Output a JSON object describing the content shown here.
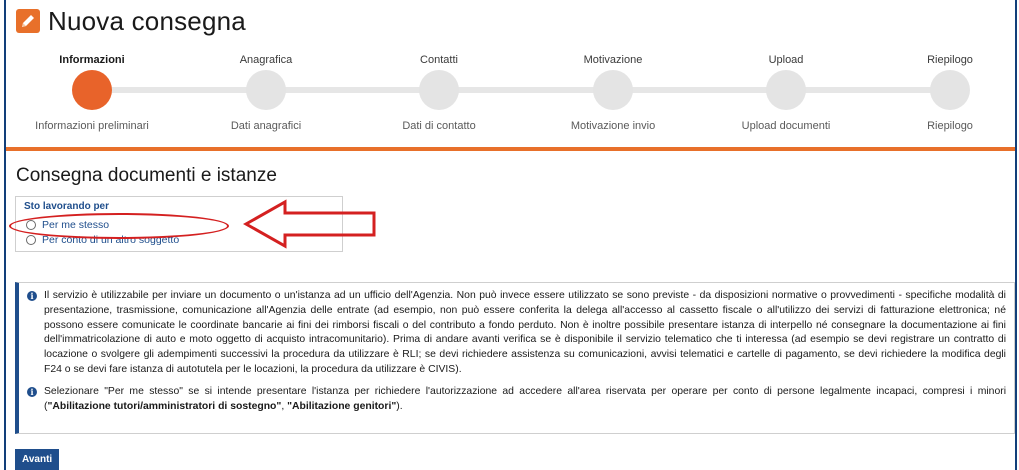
{
  "header": {
    "title": "Nuova consegna",
    "icon": "pencil-icon",
    "icon_color": "#e8702a"
  },
  "stepper": {
    "active_color": "#e8632a",
    "steps": [
      {
        "title": "Informazioni",
        "subtitle": "Informazioni preliminari",
        "active": true
      },
      {
        "title": "Anagrafica",
        "subtitle": "Dati anagrafici",
        "active": false
      },
      {
        "title": "Contatti",
        "subtitle": "Dati di contatto",
        "active": false
      },
      {
        "title": "Motivazione",
        "subtitle": "Motivazione invio",
        "active": false
      },
      {
        "title": "Upload",
        "subtitle": "Upload documenti",
        "active": false
      },
      {
        "title": "Riepilogo",
        "subtitle": "Riepilogo",
        "active": false
      }
    ]
  },
  "main": {
    "section_title": "Consegna documenti e istanze",
    "working_for": {
      "legend": "Sto lavorando per",
      "options": [
        {
          "label": "Per me stesso",
          "selected": false
        },
        {
          "label": "Per conto di un altro soggetto",
          "selected": false
        }
      ]
    },
    "info": [
      "Il servizio è utilizzabile per inviare un documento o un'istanza ad un ufficio dell'Agenzia. Non può invece essere utilizzato se sono previste - da disposizioni normative o provvedimenti - specifiche modalità di presentazione, trasmissione, comunicazione all'Agenzia delle entrate (ad esempio, non può essere conferita la delega all'accesso al cassetto fiscale o all'utilizzo dei servizi di fatturazione elettronica; né possono essere comunicate le coordinate bancarie ai fini dei rimborsi fiscali o del contributo a fondo perduto. Non è inoltre possibile presentare istanza di interpello né consegnare la documentazione ai fini dell'immatricolazione di auto e moto oggetto di acquisto intracomunitario). Prima di andare avanti verifica se è disponibile il servizio telematico che ti interessa (ad esempio se devi registrare un contratto di locazione o svolgere gli adempimenti successivi la procedura da utilizzare è RLI; se devi richiedere assistenza su comunicazioni, avvisi telematici e cartelle di pagamento, se devi richiedere la modifica degli F24 o se devi fare istanza di autotutela per le locazioni, la procedura da utilizzare è CIVIS).",
      {
        "prefix": "Selezionare \"Per me stesso\" se si intende presentare l'istanza per richiedere l'autorizzazione ad accedere all'area riservata per operare per conto di persone legalmente incapaci, compresi i minori (",
        "bold1": "\"Abilitazione tutori/amministratori di sostegno\"",
        "middle": ", ",
        "bold2": "\"Abilitazione genitori\"",
        "suffix": ")."
      }
    ],
    "next_button": "Avanti"
  },
  "annotation": {
    "color": "#d42020"
  }
}
